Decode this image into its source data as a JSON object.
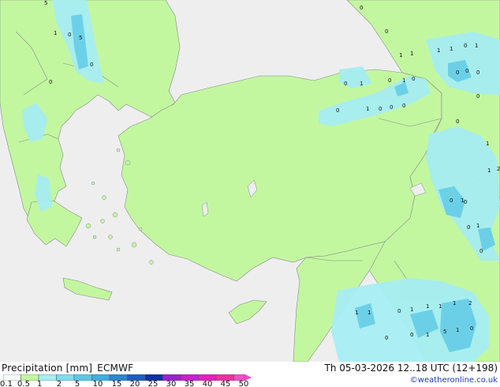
{
  "map": {
    "colors": {
      "sea": "#eeeeee",
      "land_precip": "#c2f7a0",
      "light_blue": "#a6edf2",
      "mid_blue": "#68cfe7",
      "border": "#8a8a8a"
    },
    "point_labels": [
      "5",
      "1",
      "0",
      "5",
      "0",
      "0",
      "0",
      "0",
      "1",
      "1",
      "0",
      "1",
      "0",
      "1",
      "0",
      "1",
      "1",
      "0",
      "1",
      "0",
      "0",
      "0",
      "0",
      "1",
      "0",
      "0",
      "0",
      "0",
      "0",
      "1",
      "1",
      "2",
      "1",
      "0",
      "1",
      "0",
      "0",
      "0",
      "1",
      "1",
      "0",
      "1",
      "1",
      "1",
      "1",
      "2",
      "0",
      "1",
      "5",
      "1",
      "0",
      "0"
    ]
  },
  "footer": {
    "title": "Precipitation [mm]",
    "model": "ECMWF",
    "datetime": "Th 05-03-2026 12..18 UTC (12+198)",
    "credit": "©weatheronline.co.uk"
  },
  "legend": {
    "ticks": [
      "0.1",
      "0.5",
      "1",
      "2",
      "5",
      "10",
      "15",
      "20",
      "25",
      "30",
      "35",
      "40",
      "45",
      "50"
    ],
    "colors": [
      "#f7fff7",
      "#c2f7a0",
      "#a6edf2",
      "#7fdcec",
      "#5ac9e6",
      "#3ab0e0",
      "#2a86d6",
      "#1c5cc6",
      "#0e2fa8",
      "#9a1fd0",
      "#c81fd0",
      "#e81fc0",
      "#f02fa0",
      "#f04fc8"
    ]
  }
}
